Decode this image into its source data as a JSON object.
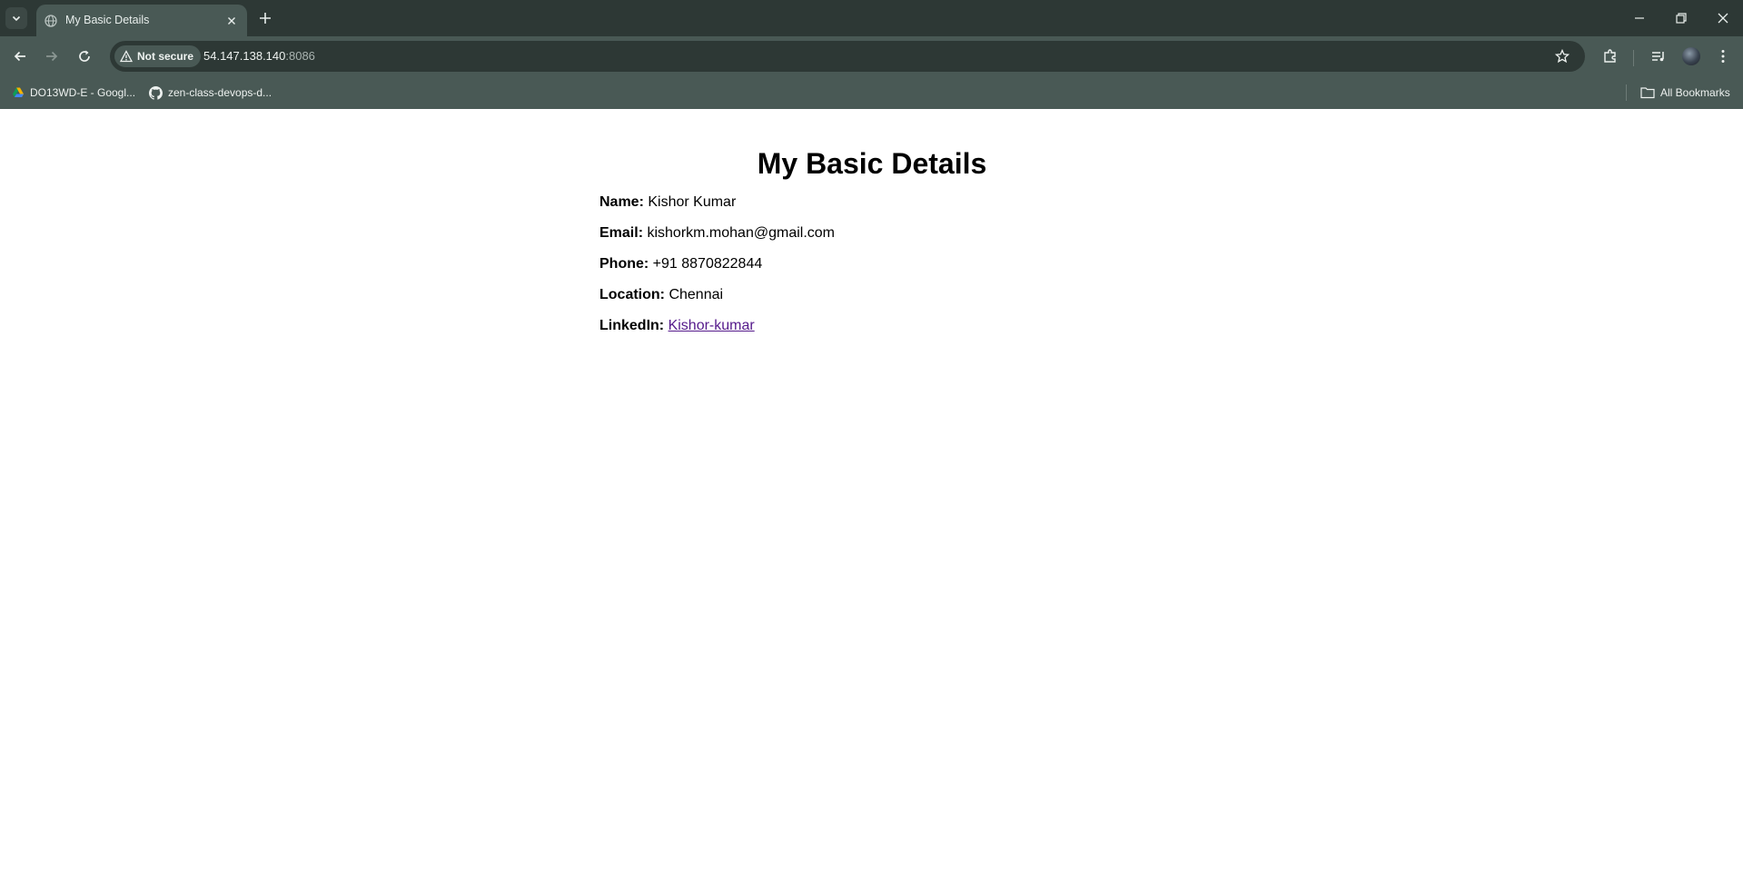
{
  "browser": {
    "tab": {
      "title": "My Basic Details"
    },
    "address_bar": {
      "security_label": "Not secure",
      "url_host": "54.147.138.140",
      "url_port": ":8086"
    },
    "bookmarks": [
      {
        "label": "DO13WD-E - Googl...",
        "icon": "google-drive-icon"
      },
      {
        "label": "zen-class-devops-d...",
        "icon": "github-icon"
      }
    ],
    "all_bookmarks_label": "All Bookmarks"
  },
  "page": {
    "heading": "My Basic Details",
    "details": [
      {
        "label": "Name:",
        "value": "Kishor Kumar"
      },
      {
        "label": "Email:",
        "value": "kishorkm.mohan@gmail.com"
      },
      {
        "label": "Phone:",
        "value": "+91 8870822844"
      },
      {
        "label": "Location:",
        "value": "Chennai"
      }
    ],
    "linkedin": {
      "label": "LinkedIn:",
      "link_text": "Kishor-kumar"
    }
  },
  "colors": {
    "tabstrip": "#2d3835",
    "toolbar": "#495955",
    "visited_link": "#551a8b"
  }
}
